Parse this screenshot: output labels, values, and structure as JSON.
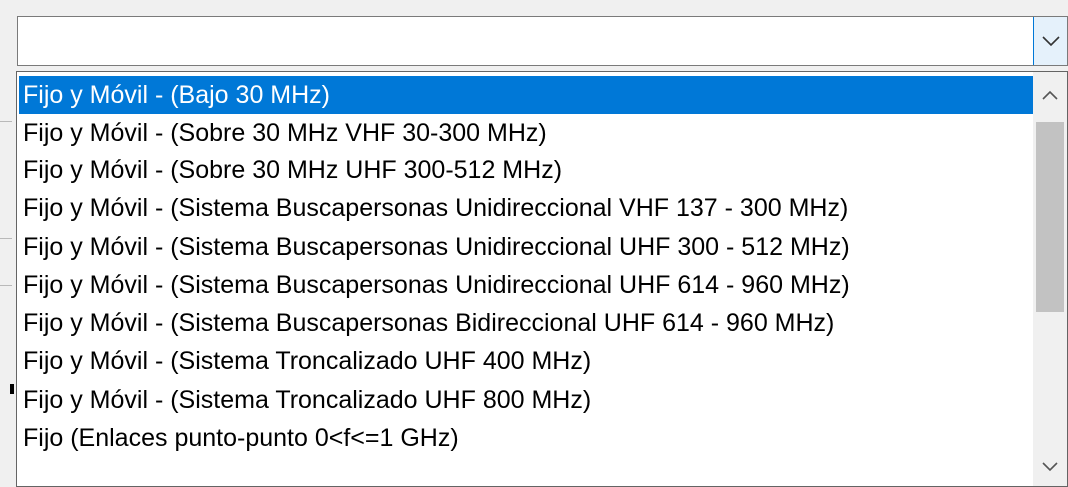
{
  "combo": {
    "value": "",
    "button_icon": "chevron-down-icon"
  },
  "dropdown": {
    "items": [
      {
        "label": "Fijo y Móvil - (Bajo 30 MHz)",
        "selected": true
      },
      {
        "label": "Fijo y Móvil - (Sobre 30 MHz VHF 30-300 MHz)",
        "selected": false
      },
      {
        "label": "Fijo y Móvil - (Sobre 30 MHz UHF 300-512 MHz)",
        "selected": false
      },
      {
        "label": "Fijo y Móvil - (Sistema Buscapersonas Unidireccional VHF 137 - 300 MHz)",
        "selected": false
      },
      {
        "label": "Fijo y Móvil - (Sistema Buscapersonas Unidireccional UHF 300 - 512 MHz)",
        "selected": false
      },
      {
        "label": "Fijo y Móvil - (Sistema Buscapersonas Unidireccional UHF 614 - 960 MHz)",
        "selected": false
      },
      {
        "label": "Fijo y Móvil - (Sistema Buscapersonas Bidireccional UHF 614 - 960 MHz)",
        "selected": false
      },
      {
        "label": "Fijo y Móvil - (Sistema Troncalizado UHF 400 MHz)",
        "selected": false
      },
      {
        "label": "Fijo y Móvil - (Sistema Troncalizado UHF 800 MHz)",
        "selected": false
      },
      {
        "label": "Fijo (Enlaces punto-punto 0<f<=1 GHz)",
        "selected": false
      }
    ],
    "scroll_up_icon": "chevron-up-icon",
    "scroll_down_icon": "chevron-down-icon"
  },
  "colors": {
    "selection": "#0078d7",
    "scroll_thumb": "#c2c2c2"
  }
}
